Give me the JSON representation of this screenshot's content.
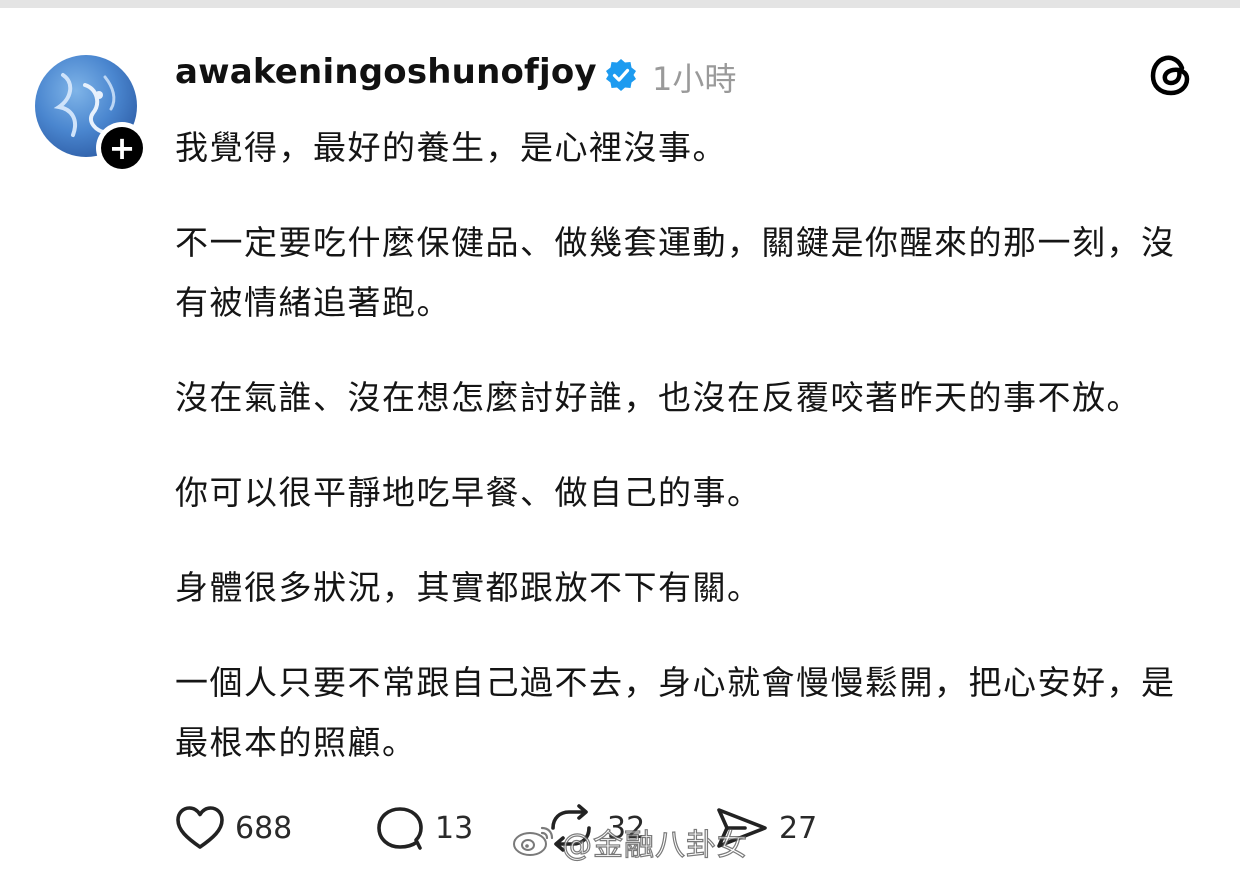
{
  "post": {
    "username": "awakeningoshunofjoy",
    "timestamp": "1小時",
    "paragraphs": [
      "我覺得，最好的養生，是心裡沒事。",
      "不一定要吃什麼保健品、做幾套運動，關鍵是你醒來的那一刻，沒有被情緒追著跑。",
      "沒在氣誰、沒在想怎麼討好誰，也沒在反覆咬著昨天的事不放。",
      "你可以很平靜地吃早餐、做自己的事。",
      "身體很多狀況，其實都跟放不下有關。",
      "一個人只要不常跟自己過不去，身心就會慢慢鬆開，把心安好，是最根本的照顧。"
    ]
  },
  "actions": {
    "like_count": "688",
    "reply_count": "13",
    "repost_count": "32",
    "share_count": "27"
  },
  "watermark": {
    "text": "@金融八卦女"
  },
  "icons": {
    "verified": "verified-badge-icon",
    "threads": "threads-logo-icon",
    "like": "heart-icon",
    "reply": "comment-bubble-icon",
    "repost": "repost-arrows-icon",
    "share": "paper-plane-icon",
    "follow": "plus-icon"
  },
  "colors": {
    "verified_blue": "#1d9bf0",
    "timestamp_gray": "#9a9a9a",
    "text": "#151515"
  }
}
